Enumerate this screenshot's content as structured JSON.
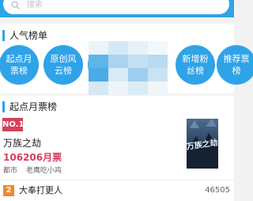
{
  "search": {
    "placeholder": "搜索"
  },
  "popular": {
    "title": "人气榜单",
    "items": [
      {
        "label": "起点月票榜"
      },
      {
        "label": "原创风云榜"
      },
      {
        "label": ""
      },
      {
        "label": "新增粉丝榜"
      },
      {
        "label": "推荐票榜"
      }
    ]
  },
  "monthly": {
    "title": "起点月票榜",
    "top": {
      "rank": "NO.1",
      "title": "万族之劫",
      "tickets": "106206月票",
      "category": "都市",
      "author": "老鹰吃小鸡",
      "cover_text": "万族之劫"
    },
    "second": {
      "rank": "2",
      "title": "大奉打更人",
      "count": "46505"
    }
  },
  "colors": {
    "accent": "#2fa3e8",
    "rank1": "#d4405a",
    "rank2": "#f08a2e"
  }
}
